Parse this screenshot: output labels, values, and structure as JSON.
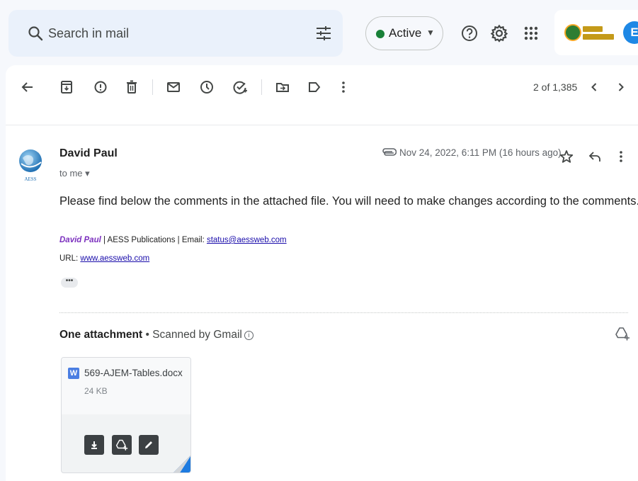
{
  "search": {
    "placeholder": "Search in mail",
    "icon": "search-icon",
    "options_icon": "tune-icon"
  },
  "status": {
    "label": "Active",
    "color": "#188038",
    "caret": "▼"
  },
  "top_icons": [
    "help-icon",
    "settings-gear-icon",
    "apps-grid-icon"
  ],
  "account": {
    "avatar_letter": "E",
    "avatar_color": "#1e88e5"
  },
  "toolbar": {
    "icons": [
      "back-arrow-icon",
      "archive-icon",
      "report-spam-icon",
      "delete-icon",
      "mark-unread-icon",
      "snooze-icon",
      "add-to-tasks-icon",
      "move-to-icon",
      "labels-icon",
      "more-vert-icon"
    ],
    "pager": {
      "text": "2 of 1,385"
    }
  },
  "message": {
    "sender": "David Paul",
    "recipient": "to me",
    "date": "Nov 24, 2022, 6:11 PM (16 hours ago)",
    "body": "Please find below the comments in the attached file. You will need to make changes according to the comments.",
    "signature": {
      "name": "David Paul",
      "org": " |  AESS Publications | Email: ",
      "email": "status@aessweb.com",
      "url_label": "URL: ",
      "url": "www.aessweb.com"
    },
    "ellipsis": "•••",
    "avatar_caption": "AESS"
  },
  "attachments": {
    "title": "One attachment",
    "separator": " • ",
    "scanned": "Scanned by Gmail",
    "file": {
      "name": "569-AJEM-Tables.docx",
      "size": "24 KB",
      "type_letter": "W"
    }
  },
  "colors": {
    "background": "#f6f8fc",
    "card": "#ffffff",
    "link": "#1a0dab",
    "signature_name": "#7b2fbe"
  }
}
